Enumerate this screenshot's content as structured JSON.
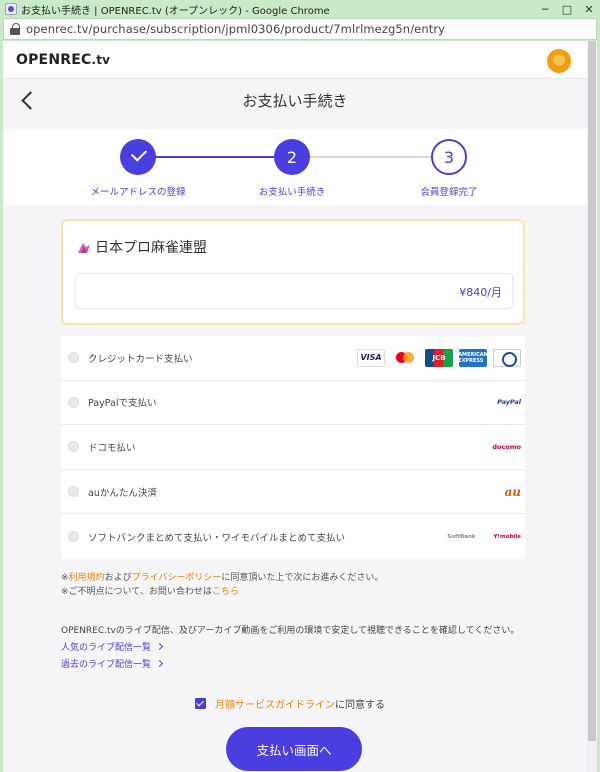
{
  "window": {
    "title": "お支払い手続き | OPENREC.tv (オープンレック) - Google Chrome",
    "minimize": "─",
    "maximize": "□",
    "close": "✕"
  },
  "address": {
    "url": "openrec.tv/purchase/subscription/jpml0306/product/7mlrlmezg5n/entry"
  },
  "header": {
    "logo": "OPENREC",
    "logo_tv": ".tv"
  },
  "page": {
    "title": "お支払い手続き"
  },
  "stepper": {
    "steps": [
      {
        "label": "メールアドレスの登録",
        "state": "done"
      },
      {
        "label": "お支払い手続き",
        "number": "2",
        "state": "current"
      },
      {
        "label": "会員登録完了",
        "number": "3",
        "state": "upcoming"
      }
    ]
  },
  "product": {
    "name": "日本プロ麻雀連盟",
    "price": "¥840/月"
  },
  "payments": [
    {
      "label": "クレジットカード支払い",
      "logos": [
        "VISA",
        "JCB",
        "AMERICAN EXPRESS"
      ]
    },
    {
      "label": "PayPalで支払い",
      "logos": [
        "PayPal"
      ]
    },
    {
      "label": "ドコモ払い",
      "logos": [
        "docomo"
      ]
    },
    {
      "label": "auかんたん決済",
      "logos": [
        "au"
      ]
    },
    {
      "label": "ソフトバンクまとめて支払い・ワイモバイルまとめて支払い",
      "logos": [
        "SoftBank",
        "Y!mobile"
      ]
    }
  ],
  "notes": {
    "prefix1": "※",
    "terms": "利用規約",
    "and": "および",
    "privacy": "プライバシーポリシー",
    "agree_text": "に同意頂いた上で次にお進みください。",
    "prefix2": "※ご不明点について、お問い合わせは",
    "contact": "こちら"
  },
  "info": {
    "text": "OPENREC.tvのライブ配信、及びアーカイブ動画をご利用の環境で安定して視聴できることを確認してください。",
    "link1": "人気のライブ配信一覧",
    "link2": "過去のライブ配信一覧"
  },
  "agreement": {
    "guideline": "月額サービスガイドライン",
    "suffix": "に同意する",
    "checked": true
  },
  "submit": {
    "label": "支払い画面へ"
  },
  "colors": {
    "accent": "#4a3ee0",
    "orange": "#e8850c",
    "window_frame": "#c9eac6"
  }
}
